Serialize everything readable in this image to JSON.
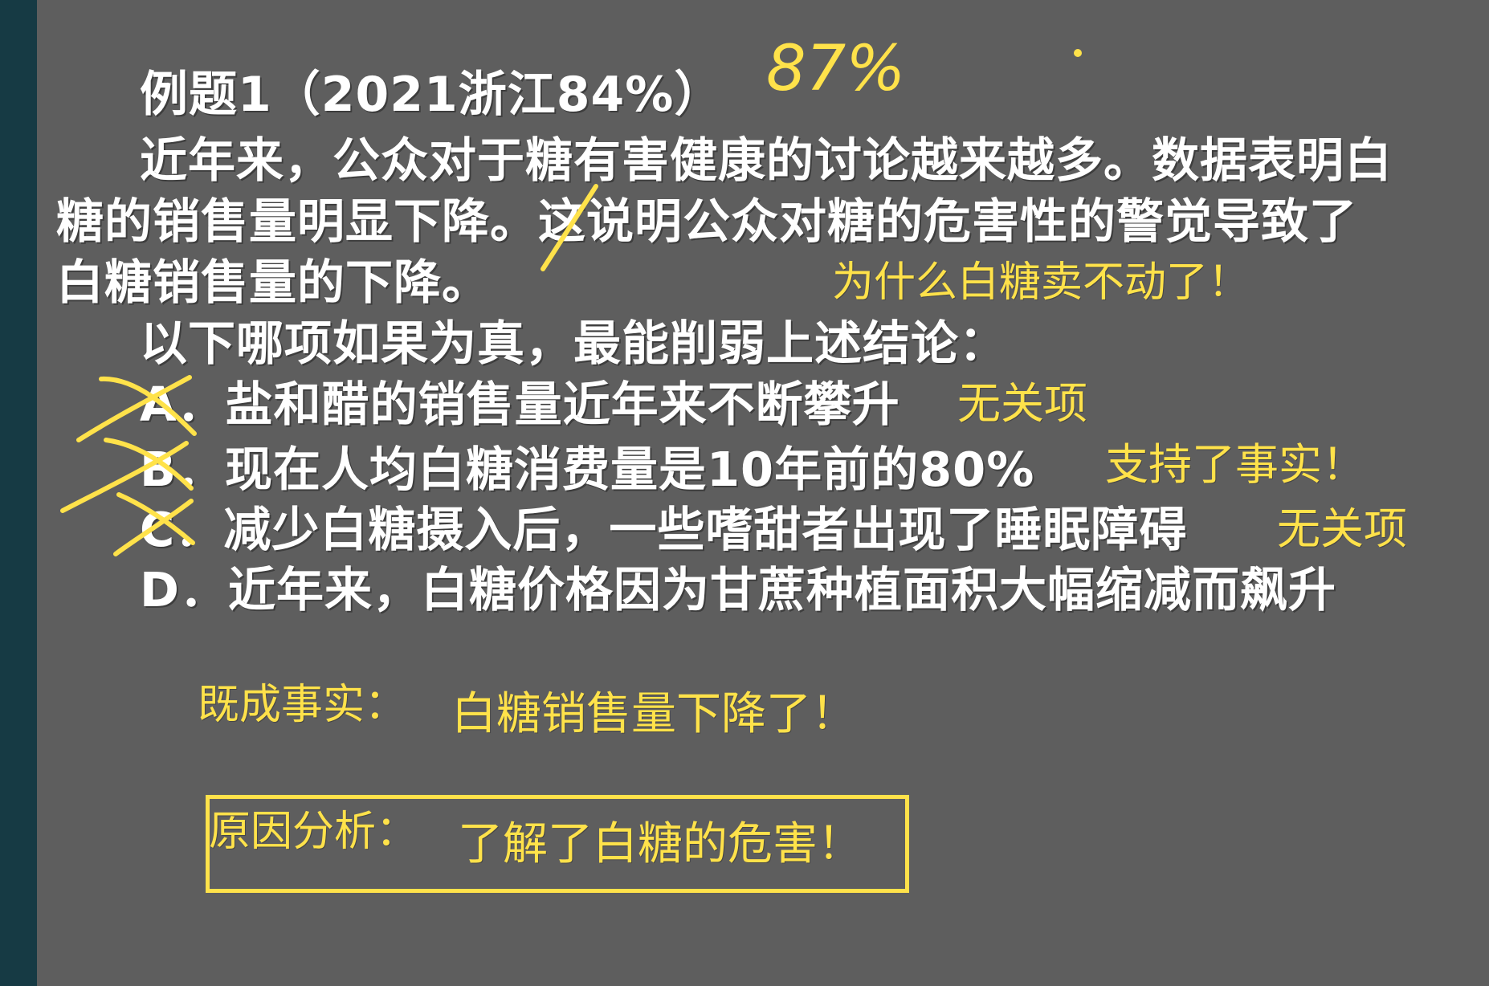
{
  "slide": {
    "title": "例题1（2021浙江84%）",
    "passage": [
      "近年来，公众对于糖有害健康的讨论越来越多。数据表明白",
      "糖的销售量明显下降。这说明公众对糖的危害性的警觉导致了",
      "白糖销售量的下降。"
    ],
    "question": "以下哪项如果为真，最能削弱上述结论：",
    "options": [
      {
        "letter": "A",
        "text": "．盐和醋的销售量近年来不断攀升"
      },
      {
        "letter": "B",
        "text": "．现在人均白糖消费量是10年前的80%"
      },
      {
        "letter": "C",
        "text": "．减少白糖摄入后，一些嗜甜者出现了睡眠障碍"
      },
      {
        "letter": "D",
        "text": "．近年来，白糖价格因为甘蔗种植面积大幅缩减而飙升"
      }
    ]
  },
  "annotations": {
    "handwritten_rate": "87%",
    "why_note": "为什么白糖卖不动了！",
    "option_a_note": "无关项",
    "option_b_note": "支持了事实！",
    "option_c_note": "无关项",
    "fact_label": "既成事实：",
    "fact_text": "白糖销售量下降了！",
    "reason_label": "原因分析：",
    "reason_text": "了解了白糖的危害！"
  },
  "colors": {
    "background": "#5e5e5e",
    "sidebar": "#163a44",
    "text": "#ffffff",
    "annotation": "#ffe24a"
  }
}
